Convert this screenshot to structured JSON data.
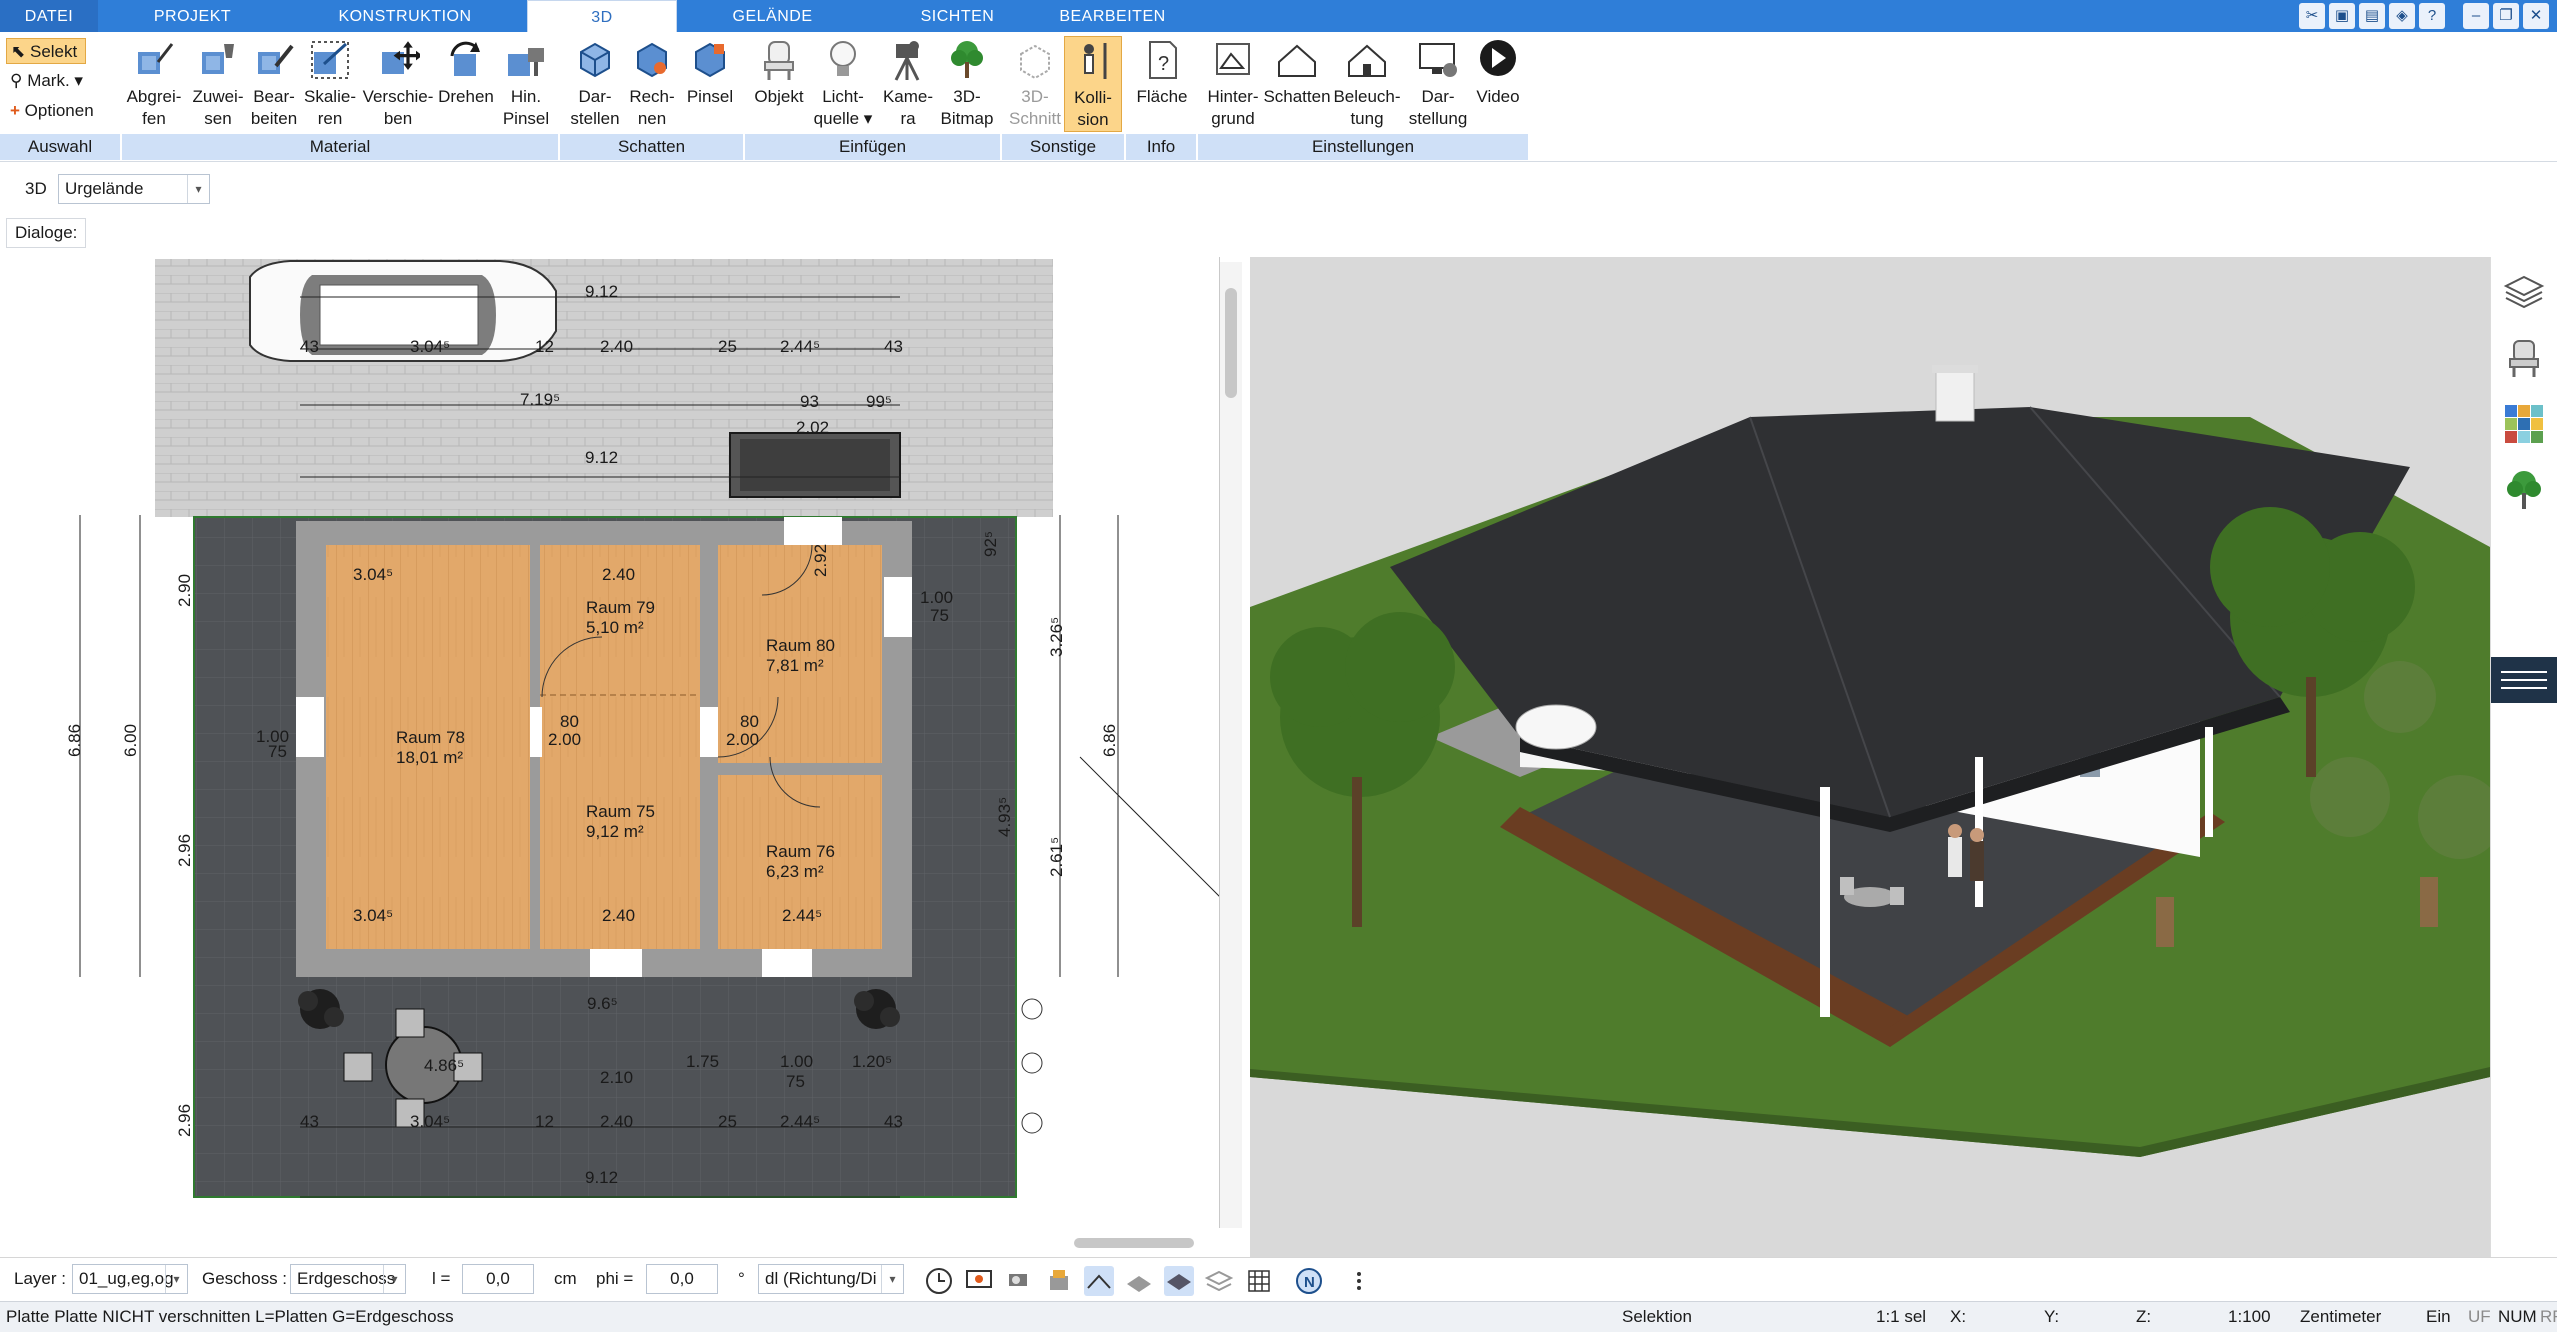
{
  "tabs": [
    {
      "label": "DATEI"
    },
    {
      "label": "PROJEKT"
    },
    {
      "label": "KONSTRUKTION"
    },
    {
      "label": "3D"
    },
    {
      "label": "GELÄNDE"
    },
    {
      "label": "SICHTEN"
    },
    {
      "label": "BEARBEITEN"
    }
  ],
  "selection": {
    "selekt": "Selekt",
    "mark": "Mark.",
    "optionen": "Optionen"
  },
  "ribbon": {
    "material": [
      {
        "l1": "Abgrei-",
        "l2": "fen"
      },
      {
        "l1": "Zuwei-",
        "l2": "sen"
      },
      {
        "l1": "Bear-",
        "l2": "beiten"
      },
      {
        "l1": "Skalie-",
        "l2": "ren"
      },
      {
        "l1": "Verschie-",
        "l2": "ben"
      },
      {
        "l1": "Drehen",
        "l2": ""
      },
      {
        "l1": "Hin.",
        "l2": "Pinsel"
      }
    ],
    "schatten": [
      {
        "l1": "Dar-",
        "l2": "stellen"
      },
      {
        "l1": "Rech-",
        "l2": "nen"
      },
      {
        "l1": "Pinsel",
        "l2": ""
      }
    ],
    "einfuegen": [
      {
        "l1": "Objekt",
        "l2": ""
      },
      {
        "l1": "Licht-",
        "l2": "quelle"
      },
      {
        "l1": "Kame-",
        "l2": "ra"
      },
      {
        "l1": "3D-",
        "l2": "Bitmap"
      }
    ],
    "sonstige": [
      {
        "l1": "3D-",
        "l2": "Schnitt"
      },
      {
        "l1": "Kolli-",
        "l2": "sion"
      }
    ],
    "info": [
      {
        "l1": "Fläche",
        "l2": ""
      }
    ],
    "einstellungen": [
      {
        "l1": "Hinter-",
        "l2": "grund"
      },
      {
        "l1": "Schatten",
        "l2": ""
      },
      {
        "l1": "Beleuch-",
        "l2": "tung"
      },
      {
        "l1": "Dar-",
        "l2": "stellung"
      },
      {
        "l1": "Video",
        "l2": ""
      }
    ],
    "groups": {
      "auswahl": "Auswahl",
      "material": "Material",
      "schatten": "Schatten",
      "einfuegen": "Einfügen",
      "sonstige": "Sonstige",
      "info": "Info",
      "einstellungen": "Einstellungen"
    }
  },
  "toolbar": {
    "mode": "3D",
    "terrain": "Urgelände",
    "dialoge": "Dialoge:"
  },
  "plan": {
    "rooms": [
      {
        "name": "Raum 78",
        "area": "18,01 m²"
      },
      {
        "name": "Raum 79",
        "area": "5,10 m²"
      },
      {
        "name": "Raum 80",
        "area": "7,81 m²"
      },
      {
        "name": "Raum 75",
        "area": "9,12 m²"
      },
      {
        "name": "Raum 76",
        "area": "6,23 m²"
      }
    ],
    "dims": {
      "d912": "9.12",
      "d3045": "3.04⁵",
      "d240": "2.40",
      "d2445": "2.44⁵",
      "d43": "43",
      "d25": "25",
      "d12": "12",
      "d7195": "7.19⁵",
      "d93": "93",
      "d995": "99⁵",
      "d202": "2.02",
      "d686": "6.86",
      "d600": "6.00",
      "d290": "2.90",
      "d100": "1.00",
      "d75": "75",
      "d296": "2.96",
      "d3265": "3.26⁵",
      "d4935": "4.93⁵",
      "d2615": "2.61⁵",
      "d80": "80",
      "d200": "2.00",
      "d210": "2.10",
      "d175": "1.75",
      "d1205": "1.20⁵",
      "d4865": "4.86⁵",
      "d965": "9.6⁵",
      "d925": "92⁵",
      "d292": "2.92"
    }
  },
  "bottom": {
    "layer_label": "Layer :",
    "layer_value": "01_ug,eg,og",
    "geschoss_label": "Geschoss :",
    "geschoss_value": "Erdgeschoss",
    "l_label": "l =",
    "l_value": "0,0",
    "cm": "cm",
    "phi_label": "phi =",
    "phi_value": "0,0",
    "deg": "°",
    "dl_value": "dl (Richtung/Di"
  },
  "status": {
    "message": "Platte Platte NICHT verschnitten L=Platten G=Erdgeschoss",
    "selektion": "Selektion",
    "sel": "1:1 sel",
    "x": "X:",
    "y": "Y:",
    "z": "Z:",
    "scale": "1:100",
    "unit": "Zentimeter",
    "ein": "Ein",
    "uf": "UF",
    "num": "NUM",
    "rf": "RF"
  },
  "colors": {
    "accent": "#2f7ed8",
    "group_bg": "#cfe0f7",
    "active_btn": "#fcd58a",
    "floor_wood": "#e3a96b",
    "terrace": "#505358",
    "lawn": "#4f7c2c"
  }
}
